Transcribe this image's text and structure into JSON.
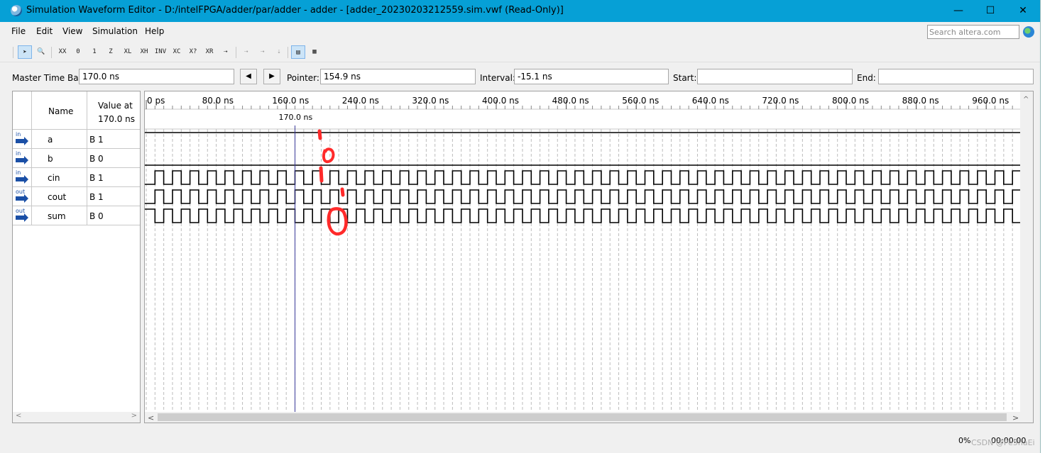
{
  "window": {
    "title": "Simulation Waveform Editor - D:/intelFPGA/adder/par/adder - adder - [adder_20230203212559.sim.vwf (Read-Only)]",
    "minimize": "—",
    "maximize": "☐",
    "close": "✕"
  },
  "menu": {
    "items": [
      "File",
      "Edit",
      "View",
      "Simulation",
      "Help"
    ]
  },
  "search": {
    "placeholder": "Search altera.com"
  },
  "toolbar": {
    "tools": [
      "pointer-icon",
      "zoom-icon",
      "forcing-unknown-icon",
      "forcing-low-icon",
      "forcing-high-icon",
      "high-impedance-icon",
      "weak-low-icon",
      "weak-high-icon",
      "invert-icon",
      "count-value-icon",
      "clock-icon",
      "random-value-icon",
      "arbitrary-value-icon",
      "snap-to-grid-icon",
      "ungroup-icon",
      "reverse-group-icon",
      "overwrite-clock-icon",
      "grid-icon"
    ],
    "glyphs": [
      "➤",
      "🔍",
      "XX",
      "0",
      "1",
      "Z",
      "XL",
      "XH",
      "INV",
      "XC",
      "X?",
      "XR",
      "⇢",
      "⇢",
      "⇢",
      "⇣",
      "▤",
      "▦"
    ]
  },
  "timebar": {
    "master_label": "Master Time Bar:",
    "master_value": "170.0 ns",
    "prev": "◀",
    "next": "▶",
    "pointer_label": "Pointer:",
    "pointer_value": "154.9 ns",
    "interval_label": "Interval:",
    "interval_value": "-15.1 ns",
    "start_label": "Start:",
    "start_value": "",
    "end_label": "End:",
    "end_value": ""
  },
  "signal_table": {
    "name_header": "Name",
    "value_header": "Value at\n170.0 ns",
    "rows": [
      {
        "dir": "in",
        "name": "a",
        "value": "B 1"
      },
      {
        "dir": "in",
        "name": "b",
        "value": "B 0"
      },
      {
        "dir": "in",
        "name": "cin",
        "value": "B 1"
      },
      {
        "dir": "out",
        "name": "cout",
        "value": "B 1"
      },
      {
        "dir": "out",
        "name": "sum",
        "value": "B 0"
      }
    ]
  },
  "timeline": {
    "ticks": [
      "0 ps",
      "80.0 ns",
      "160.0 ns",
      "240.0 ns",
      "320.0 ns",
      "400.0 ns",
      "480.0 ns",
      "560.0 ns",
      "640.0 ns",
      "720.0 ns",
      "800.0 ns",
      "880.0 ns",
      "960.0 ns"
    ],
    "master_marker_label": "170.0 ns",
    "master_marker_ns": 170,
    "period_ns": 20,
    "ns_per_major_tick": 80
  },
  "waveforms": {
    "a": {
      "type": "constant",
      "level": 1
    },
    "b": {
      "type": "constant",
      "level": 0
    },
    "cin": {
      "type": "clock",
      "half_period_ns": 10,
      "start_level": 0
    },
    "cout": {
      "type": "clock",
      "half_period_ns": 10,
      "start_level": 0
    },
    "sum": {
      "type": "clock",
      "half_period_ns": 10,
      "start_level": 1
    }
  },
  "colors": {
    "titlebar": "#06a0d6",
    "annotation": "#ff2a2a",
    "marker": "#3a3a9a"
  },
  "status": {
    "progress": "0%",
    "time": "00:00:00",
    "watermark": "CSDN @Pe5haEi"
  }
}
